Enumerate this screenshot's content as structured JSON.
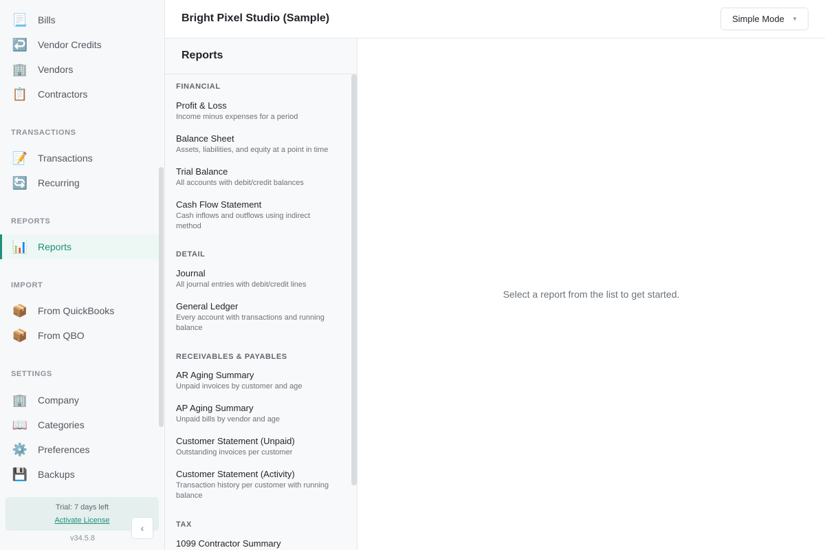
{
  "sidebar": {
    "items_top": [
      {
        "label": "Bills",
        "icon": "📃",
        "icon_name": "bill-icon"
      },
      {
        "label": "Vendor Credits",
        "icon": "↩️",
        "icon_name": "return-arrow-icon"
      },
      {
        "label": "Vendors",
        "icon": "🏢",
        "icon_name": "building-icon"
      },
      {
        "label": "Contractors",
        "icon": "📋",
        "icon_name": "clipboard-icon"
      }
    ],
    "sections": [
      {
        "title": "TRANSACTIONS",
        "items": [
          {
            "label": "Transactions",
            "icon": "📝",
            "icon_name": "memo-icon"
          },
          {
            "label": "Recurring",
            "icon": "🔄",
            "icon_name": "refresh-icon"
          }
        ]
      },
      {
        "title": "REPORTS",
        "items": [
          {
            "label": "Reports",
            "icon": "📊",
            "icon_name": "bar-chart-icon",
            "active": true
          }
        ]
      },
      {
        "title": "IMPORT",
        "items": [
          {
            "label": "From QuickBooks",
            "icon": "📦",
            "icon_name": "package-icon"
          },
          {
            "label": "From QBO",
            "icon": "📦",
            "icon_name": "package-icon"
          }
        ]
      },
      {
        "title": "SETTINGS",
        "items": [
          {
            "label": "Company",
            "icon": "🏢",
            "icon_name": "building-icon"
          },
          {
            "label": "Categories",
            "icon": "📖",
            "icon_name": "book-icon"
          },
          {
            "label": "Preferences",
            "icon": "⚙️",
            "icon_name": "gear-icon"
          },
          {
            "label": "Backups",
            "icon": "💾",
            "icon_name": "floppy-disk-icon"
          }
        ]
      }
    ],
    "trial": {
      "text": "Trial: 7 days left",
      "link": "Activate License"
    },
    "version": "v34.5.8",
    "collapse_glyph": "‹"
  },
  "header": {
    "company": "Bright Pixel Studio (Sample)",
    "mode": "Simple Mode",
    "mode_caret": "▼"
  },
  "reports": {
    "title": "Reports",
    "categories": [
      {
        "title": "FINANCIAL",
        "items": [
          {
            "name": "Profit & Loss",
            "desc": "Income minus expenses for a period"
          },
          {
            "name": "Balance Sheet",
            "desc": "Assets, liabilities, and equity at a point in time"
          },
          {
            "name": "Trial Balance",
            "desc": "All accounts with debit/credit balances"
          },
          {
            "name": "Cash Flow Statement",
            "desc": "Cash inflows and outflows using indirect method"
          }
        ]
      },
      {
        "title": "DETAIL",
        "items": [
          {
            "name": "Journal",
            "desc": "All journal entries with debit/credit lines"
          },
          {
            "name": "General Ledger",
            "desc": "Every account with transactions and running balance"
          }
        ]
      },
      {
        "title": "RECEIVABLES & PAYABLES",
        "items": [
          {
            "name": "AR Aging Summary",
            "desc": "Unpaid invoices by customer and age"
          },
          {
            "name": "AP Aging Summary",
            "desc": "Unpaid bills by vendor and age"
          },
          {
            "name": "Customer Statement (Unpaid)",
            "desc": "Outstanding invoices per customer"
          },
          {
            "name": "Customer Statement (Activity)",
            "desc": "Transaction history per customer with running balance"
          }
        ]
      },
      {
        "title": "TAX",
        "items": [
          {
            "name": "1099 Contractor Summary",
            "desc": ""
          }
        ]
      }
    ]
  },
  "main": {
    "empty_message": "Select a report from the list to get started."
  },
  "colors": {
    "accent": "#1f8f78",
    "active_bg": "#edf8f5",
    "sidebar_bg": "#f7f8f9",
    "trial_bg": "#e4efee"
  }
}
